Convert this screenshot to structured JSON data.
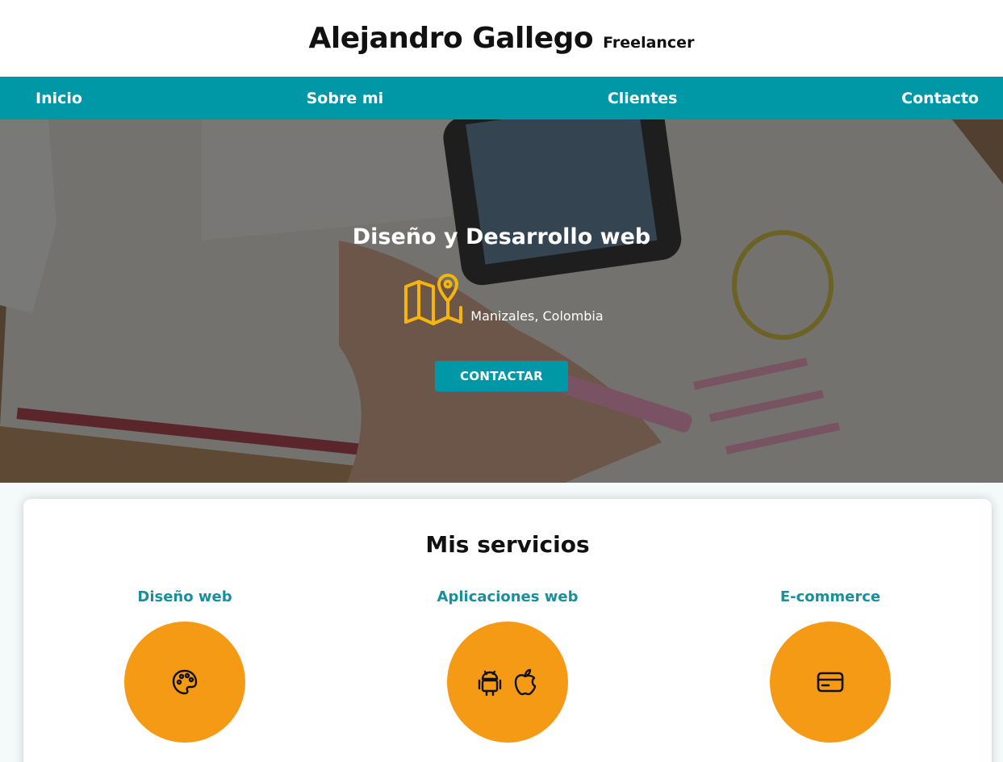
{
  "header": {
    "name": "Alejandro Gallego",
    "role": "Freelancer"
  },
  "nav": {
    "items": [
      "Inicio",
      "Sobre mi",
      "Clientes",
      "Contacto"
    ]
  },
  "hero": {
    "title": "Diseño y Desarrollo web",
    "location": "Manizales, Colombia",
    "cta_label": "CONTACTAR",
    "location_icon": "map-pin-icon",
    "accent_icon_color": "#f5b50a"
  },
  "services": {
    "title": "Mis servicios",
    "items": [
      {
        "name": "Diseño web",
        "icon": "palette-icon"
      },
      {
        "name": "Aplicaciones web",
        "icon": "android-apple-icon"
      },
      {
        "name": "E-commerce",
        "icon": "credit-card-icon"
      }
    ]
  },
  "colors": {
    "primary": "#0097a7",
    "accent": "#f59a14",
    "service_title": "#1a8f9c"
  }
}
